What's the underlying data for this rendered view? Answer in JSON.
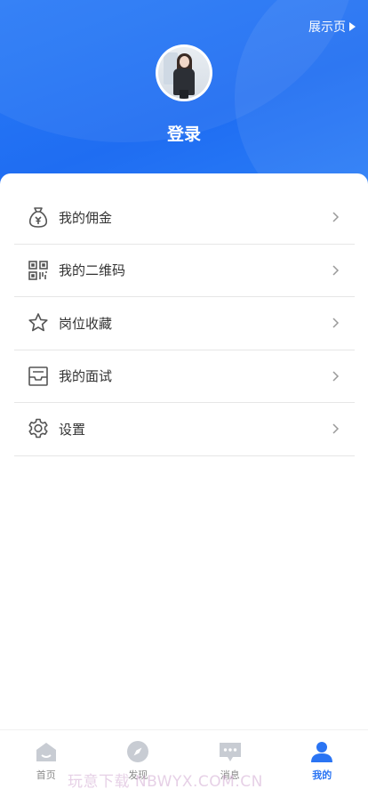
{
  "header": {
    "showcase_link": "展示页",
    "login_label": "登录"
  },
  "menu": {
    "items": [
      {
        "label": "我的佣金",
        "icon": "money-bag-icon"
      },
      {
        "label": "我的二维码",
        "icon": "qr-code-icon"
      },
      {
        "label": "岗位收藏",
        "icon": "star-icon"
      },
      {
        "label": "我的面试",
        "icon": "inbox-icon"
      },
      {
        "label": "设置",
        "icon": "gear-icon"
      }
    ]
  },
  "tabbar": {
    "tabs": [
      {
        "label": "首页",
        "icon": "home-icon",
        "active": false
      },
      {
        "label": "发现",
        "icon": "compass-icon",
        "active": false
      },
      {
        "label": "消息",
        "icon": "message-icon",
        "active": false
      },
      {
        "label": "我的",
        "icon": "user-icon",
        "active": true
      }
    ]
  },
  "watermark": "玩意下载 NBWYX.COM.CN",
  "colors": {
    "brand_blue": "#2a74f3",
    "header_gradient_start": "#2a7bf6",
    "text_primary": "#333333",
    "text_secondary": "#8a8a8a",
    "divider": "#e6e6e6"
  }
}
